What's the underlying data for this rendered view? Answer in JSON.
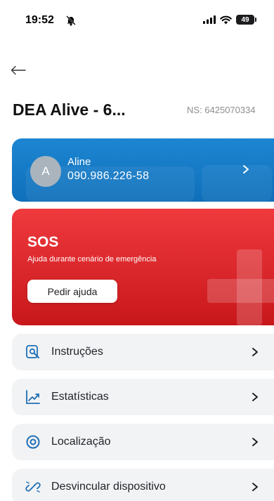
{
  "status_bar": {
    "time": "19:52",
    "battery": "49"
  },
  "header": {
    "title": "DEA Alive - 6...",
    "serial": "NS: 6425070334"
  },
  "user": {
    "initial": "A",
    "name": "Aline",
    "phone": "090.986.226-58"
  },
  "sos": {
    "title": "SOS",
    "subtitle": "Ajuda durante cenário de emergência",
    "button_label": "Pedir ajuda"
  },
  "menu": [
    {
      "label": "Instruções",
      "icon": "instructions-icon"
    },
    {
      "label": "Estatísticas",
      "icon": "chart-icon"
    },
    {
      "label": "Localização",
      "icon": "location-icon"
    },
    {
      "label": "Desvincular dispositivo",
      "icon": "unlink-icon"
    }
  ],
  "colors": {
    "user_card": "#1d86d2",
    "sos_card": "#e0262b",
    "menu_bg": "#f2f3f5",
    "icon_accent": "#1f6fb5"
  }
}
